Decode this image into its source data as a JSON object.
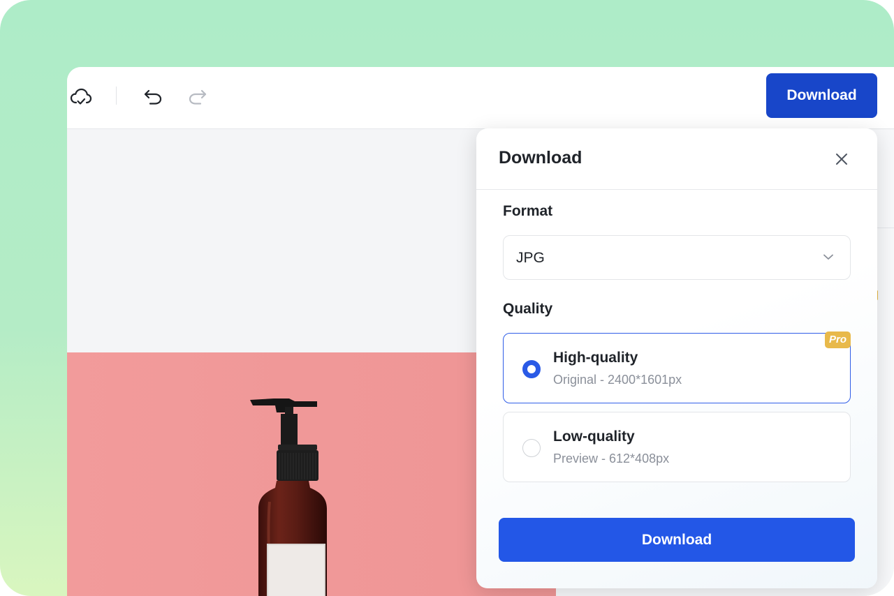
{
  "toolbar": {
    "cloud_icon": "cloud-check-icon",
    "undo_icon": "undo-icon",
    "redo_icon": "redo-icon",
    "download_label": "Download"
  },
  "dialog": {
    "title": "Download",
    "close_icon": "close-icon",
    "format": {
      "label": "Format",
      "selected": "JPG",
      "chevron_icon": "chevron-down-icon"
    },
    "quality": {
      "label": "Quality",
      "options": [
        {
          "title": "High-quality",
          "subtitle": "Original - 2400*1601px",
          "badge": "Pro",
          "selected": true
        },
        {
          "title": "Low-quality",
          "subtitle": "Preview - 612*408px",
          "selected": false
        }
      ]
    },
    "download_label": "Download"
  },
  "colors": {
    "primary": "#2357e7",
    "primary_dark": "#1846c9",
    "pro_badge": "#e8b94a",
    "photo_background": "#f29b9b",
    "frame_gradient_top": "#aeecc8",
    "frame_gradient_bottom": "#d9f6bf"
  }
}
